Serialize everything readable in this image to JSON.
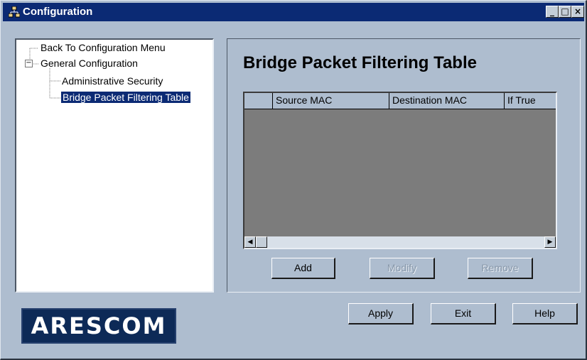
{
  "window": {
    "title": "Configuration",
    "minimize_glyph": "_",
    "maximize_glyph": "□",
    "close_glyph": "×"
  },
  "tree": {
    "items": [
      {
        "label": "Back To Configuration Menu"
      },
      {
        "label": "General Configuration",
        "expander": "−"
      },
      {
        "label": "Administrative Security"
      },
      {
        "label": "Bridge Packet Filtering Table",
        "selected": true
      }
    ]
  },
  "main": {
    "heading": "Bridge Packet Filtering Table",
    "table": {
      "columns": [
        "",
        "Source MAC",
        "Destination MAC",
        "If True"
      ],
      "rows": []
    },
    "scroll_left_glyph": "◀",
    "scroll_right_glyph": "▶",
    "buttons": {
      "add": "Add",
      "modify": "Modify",
      "remove": "Remove"
    }
  },
  "footer": {
    "logo": "ARESCOM",
    "apply": "Apply",
    "exit": "Exit",
    "help": "Help"
  },
  "colors": {
    "titlebar": "#0b2a74",
    "selection": "#0b2a74",
    "window_bg": "#aebdcf"
  }
}
